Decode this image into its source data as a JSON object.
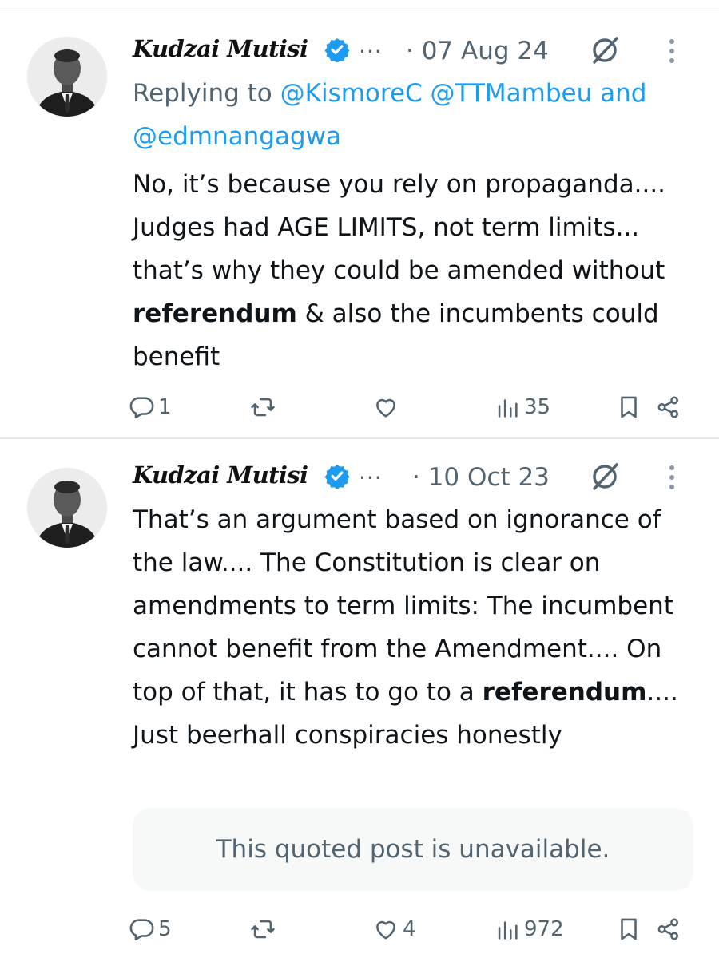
{
  "tweets": [
    {
      "author": "Kudzai Mutisi",
      "ellipsis": "...",
      "date": "· 07 Aug 24",
      "replying_to": {
        "prefix": "Replying to",
        "mention1": "@KismoreC",
        "mention2": "@TTMambeu",
        "joiner": "and",
        "mention3": "@edmnangagwa"
      },
      "text_before_bold": "No, it’s because you rely on propaganda.... Judges had AGE LIMITS, not term limits... that’s why they could be amended without ",
      "text_bold": "referendum",
      "text_after_bold": " & also the incumbents could benefit",
      "stats": {
        "replies": "1",
        "retweets": "",
        "likes": "",
        "views": "35"
      }
    },
    {
      "author": "Kudzai Mutisi",
      "ellipsis": "...",
      "date": "· 10 Oct 23",
      "text_before_bold": "That’s an argument based on ignorance of the law.... The Constitution is clear on amendments to term limits: The incumbent cannot benefit from the Amendment.... On top of that, it has to go to a ",
      "text_bold": "referendum",
      "text_after_bold": ".... Just beerhall conspiracies honestly",
      "quoted_post": "This quoted post is unavailable.",
      "stats": {
        "replies": "5",
        "retweets": "",
        "likes": "4",
        "views": "972"
      }
    }
  ],
  "icons": {
    "verified": "verified-badge-icon",
    "grok": "grok-icon",
    "more": "more-options-icon",
    "reply": "reply-icon",
    "retweet": "retweet-icon",
    "like": "heart-icon",
    "views": "views-icon",
    "bookmark": "bookmark-icon",
    "share": "share-icon"
  },
  "colors": {
    "link": "#1d9bf0",
    "secondary_text": "#536471",
    "quoted_bg": "#f7f9f9"
  }
}
